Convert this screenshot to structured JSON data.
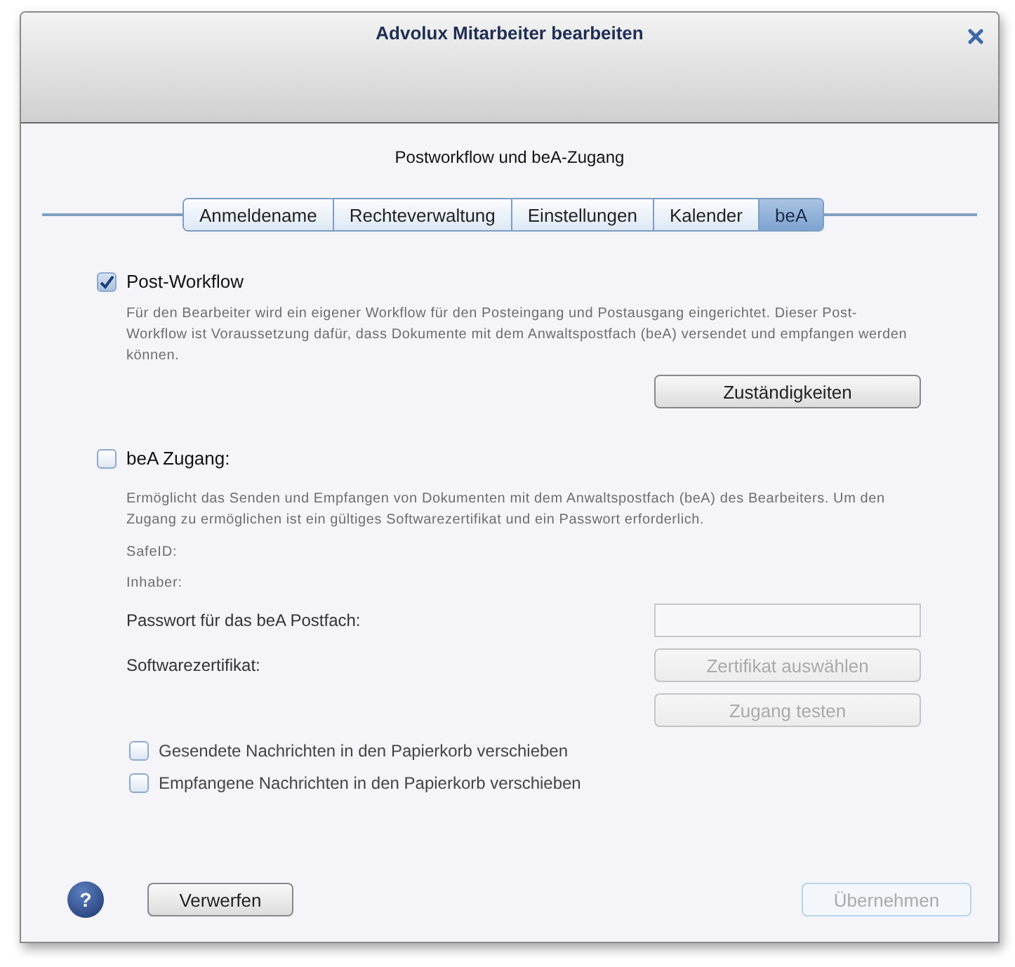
{
  "window": {
    "title": "Advolux Mitarbeiter bearbeiten"
  },
  "subtitle": "Postworkflow und beA-Zugang",
  "tabs": [
    {
      "label": "Anmeldename",
      "selected": false
    },
    {
      "label": "Rechteverwaltung",
      "selected": false
    },
    {
      "label": "Einstellungen",
      "selected": false
    },
    {
      "label": "Kalender",
      "selected": false
    },
    {
      "label": "beA",
      "selected": true
    }
  ],
  "post_workflow": {
    "label": "Post-Workflow",
    "checked": true,
    "description": "Für den Bearbeiter wird ein eigener Workflow für den Posteingang und Postausgang eingerichtet. Dieser Post-Workflow ist Voraussetzung dafür, dass Dokumente mit dem Anwaltspostfach (beA) versendet und empfangen werden können.",
    "button": {
      "label": "Zuständigkeiten",
      "disabled": false
    }
  },
  "bea_access": {
    "label": "beA Zugang:",
    "checked": false,
    "description": "Ermöglicht das Senden und Empfangen von Dokumenten mit dem Anwaltspostfach (beA) des Bearbeiters. Um den Zugang zu ermöglichen ist ein gültiges Softwarezertifikat und ein Passwort erforderlich.",
    "info": [
      "SafeID:",
      "Inhaber:"
    ],
    "password_label": "Passwort für das beA Postfach:",
    "certificate_label": "Softwarezertifikat:",
    "buttons": [
      {
        "label": "Zertifikat auswählen",
        "disabled": true
      },
      {
        "label": "Zugang testen",
        "disabled": true
      }
    ],
    "options": [
      {
        "label": "Gesendete Nachrichten in den Papierkorb verschieben",
        "checked": false
      },
      {
        "label": "Empfangene Nachrichten in den Papierkorb verschieben",
        "checked": false
      }
    ]
  },
  "footer": {
    "help": "?",
    "discard": {
      "label": "Verwerfen",
      "disabled": false
    },
    "apply": {
      "label": "Übernehmen",
      "disabled": true
    }
  }
}
